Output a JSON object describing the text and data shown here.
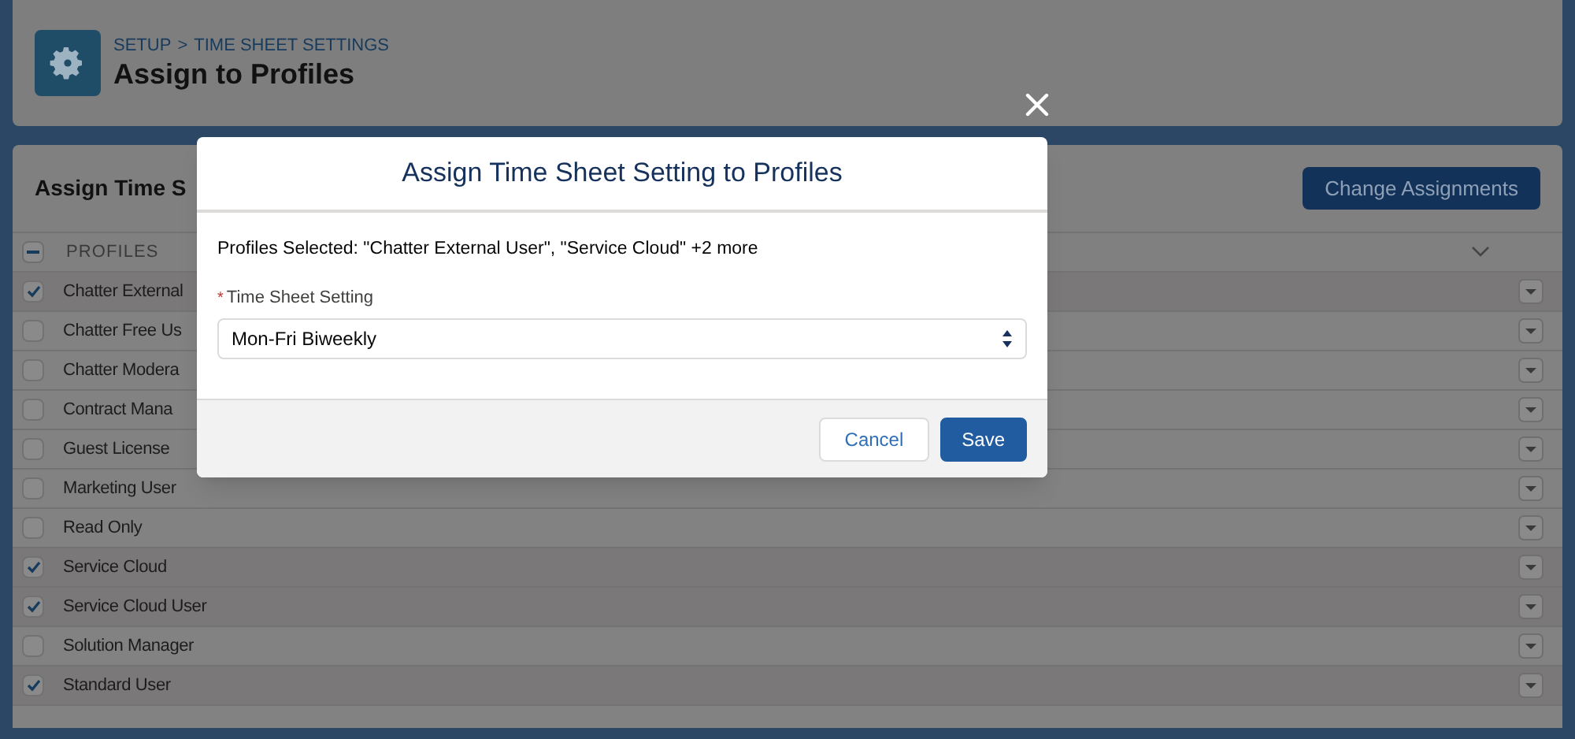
{
  "header": {
    "breadcrumb": [
      {
        "label": "SETUP"
      },
      {
        "label": ">"
      },
      {
        "label": "TIME SHEET SETTINGS"
      }
    ],
    "title": "Assign to Profiles"
  },
  "card": {
    "title": "Assign Time S",
    "button": "Change Assignments",
    "column": "PROFILES",
    "select_all": {
      "indeterminate": true
    },
    "rows": [
      {
        "name": "Chatter External",
        "selected": true
      },
      {
        "name": "Chatter Free Us",
        "selected": false
      },
      {
        "name": "Chatter Modera",
        "selected": false
      },
      {
        "name": "Contract Mana",
        "selected": false
      },
      {
        "name": "Guest License",
        "selected": false
      },
      {
        "name": "Marketing User",
        "selected": false
      },
      {
        "name": "Read Only",
        "selected": false
      },
      {
        "name": "Service Cloud",
        "selected": true
      },
      {
        "name": "Service Cloud User",
        "selected": true
      },
      {
        "name": "Solution Manager",
        "selected": false
      },
      {
        "name": "Standard User",
        "selected": true
      }
    ]
  },
  "modal": {
    "title": "Assign Time Sheet Setting to Profiles",
    "summary": "Profiles Selected: \"Chatter External User\", \"Service Cloud\" +2 more",
    "field_label": "Time Sheet Setting",
    "required_mark": "*",
    "field_value": "Mon-Fri Biweekly",
    "buttons": [
      {
        "label": "Cancel",
        "kind": "neutral"
      },
      {
        "label": "Save",
        "kind": "brand"
      }
    ]
  }
}
